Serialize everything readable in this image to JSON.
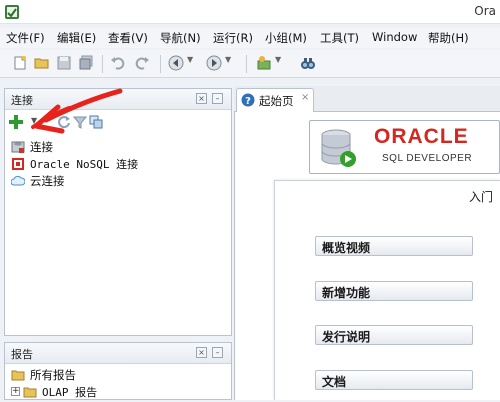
{
  "window": {
    "title": "Ora"
  },
  "menu": [
    {
      "label": "文件(F)"
    },
    {
      "label": "编辑(E)"
    },
    {
      "label": "查看(V)"
    },
    {
      "label": "导航(N)"
    },
    {
      "label": "运行(R)"
    },
    {
      "label": "小组(M)"
    },
    {
      "label": "工具(T)"
    },
    {
      "label": "Window"
    },
    {
      "label": "帮助(H)"
    }
  ],
  "toolbar": {
    "icons": [
      "new-file-icon",
      "open-folder-icon",
      "save-icon",
      "save-all-icon",
      "undo-icon",
      "redo-icon",
      "back-icon",
      "forward-icon",
      "run-icon",
      "binoculars-icon"
    ]
  },
  "connections_pane": {
    "title": "连接",
    "items": [
      {
        "label": "连接",
        "icon": "database-connection-icon"
      },
      {
        "label": "Oracle NoSQL 连接",
        "icon": "nosql-icon"
      },
      {
        "label": "云连接",
        "icon": "cloud-icon"
      }
    ]
  },
  "reports_pane": {
    "title": "报告",
    "items": [
      {
        "label": "所有报告",
        "icon": "folder-icon"
      },
      {
        "label": "OLAP 报告",
        "icon": "folder-icon"
      }
    ]
  },
  "tabs": [
    {
      "label": "起始页",
      "icon": "help-icon"
    }
  ],
  "start_page": {
    "logo_brand": "ORACLE",
    "logo_product": "SQL DEVELOPER",
    "heading": "入门",
    "links": [
      {
        "label": "概览视频"
      },
      {
        "label": "新增功能"
      },
      {
        "label": "发行说明"
      },
      {
        "label": "文档"
      }
    ]
  },
  "colors": {
    "oracle_red": "#d3281f",
    "annotation_red": "#e8231b",
    "pane_border": "#b9c3cf"
  }
}
